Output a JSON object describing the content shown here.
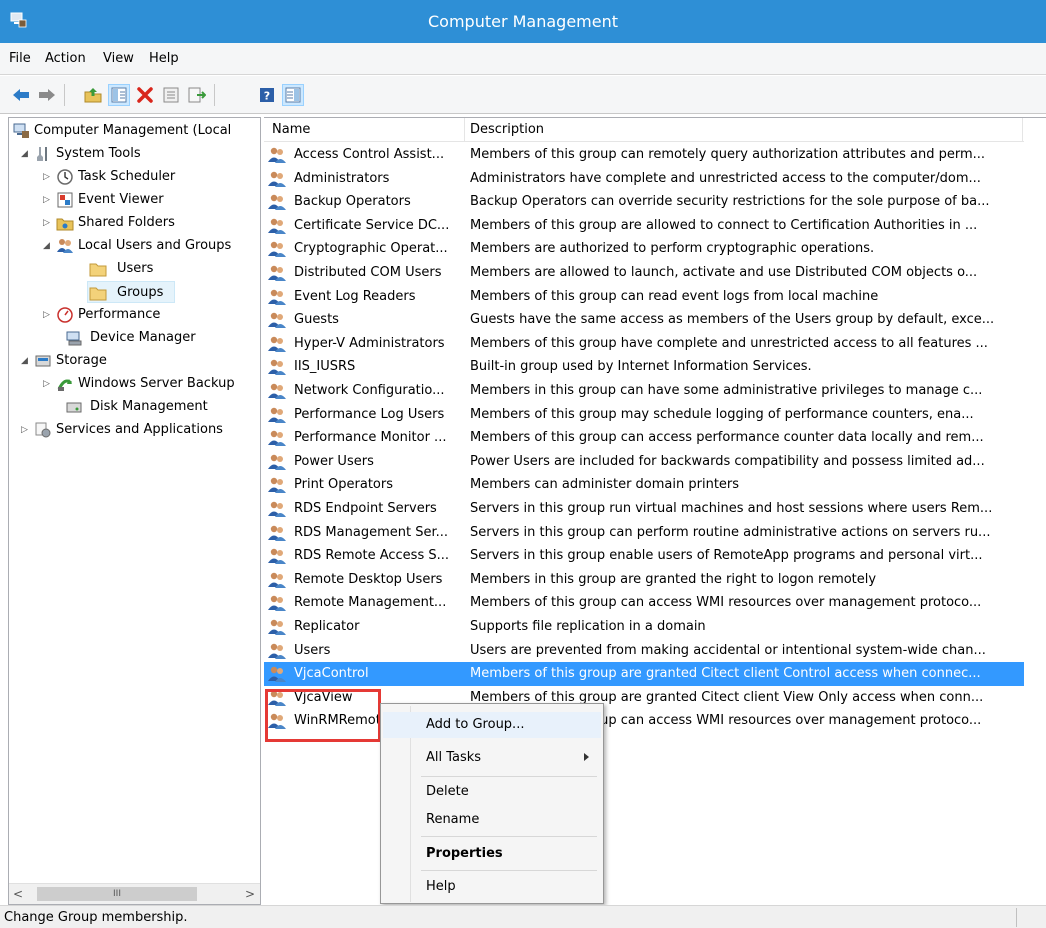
{
  "window": {
    "title": "Computer Management"
  },
  "menu": [
    "File",
    "Action",
    "View",
    "Help"
  ],
  "toolbar": [
    {
      "name": "back-icon"
    },
    {
      "name": "forward-icon"
    },
    {
      "name": "up-folder-icon"
    },
    {
      "name": "show-hide-console-tree-icon"
    },
    {
      "name": "delete-icon"
    },
    {
      "name": "properties-icon"
    },
    {
      "name": "export-list-icon"
    },
    {
      "name": "help-icon"
    },
    {
      "name": "show-hide-action-pane-icon"
    }
  ],
  "tree": [
    {
      "label": "Computer Management (Local",
      "icon": "computer-management-icon",
      "level": 0,
      "arrow": ""
    },
    {
      "label": "System Tools",
      "icon": "tools-icon",
      "level": 1,
      "arrow": "expanded"
    },
    {
      "label": "Task Scheduler",
      "icon": "clock-icon",
      "level": 2,
      "arrow": "collapsed"
    },
    {
      "label": "Event Viewer",
      "icon": "event-viewer-icon",
      "level": 2,
      "arrow": "collapsed"
    },
    {
      "label": "Shared Folders",
      "icon": "shared-folder-icon",
      "level": 2,
      "arrow": "collapsed"
    },
    {
      "label": "Local Users and Groups",
      "icon": "users-groups-icon",
      "level": 2,
      "arrow": "expanded"
    },
    {
      "label": "Users",
      "icon": "folder-icon",
      "level": 3,
      "arrow": ""
    },
    {
      "label": "Groups",
      "icon": "folder-icon",
      "level": 3,
      "arrow": "",
      "selected": true
    },
    {
      "label": "Performance",
      "icon": "performance-icon",
      "level": 2,
      "arrow": "collapsed"
    },
    {
      "label": "Device Manager",
      "icon": "device-manager-icon",
      "level": 2,
      "arrow": ""
    },
    {
      "label": "Storage",
      "icon": "storage-icon",
      "level": 1,
      "arrow": "expanded"
    },
    {
      "label": "Windows Server Backup",
      "icon": "backup-icon",
      "level": 2,
      "arrow": "collapsed"
    },
    {
      "label": "Disk Management",
      "icon": "disk-icon",
      "level": 2,
      "arrow": ""
    },
    {
      "label": "Services and Applications",
      "icon": "services-icon",
      "level": 1,
      "arrow": "collapsed"
    }
  ],
  "tree_scroll": {
    "thumb_label": "III"
  },
  "columns": {
    "name": "Name",
    "description": "Description"
  },
  "groups": [
    {
      "name": "Access Control Assist...",
      "description": "Members of this group can remotely query authorization attributes and perm..."
    },
    {
      "name": "Administrators",
      "description": "Administrators have complete and unrestricted access to the computer/dom..."
    },
    {
      "name": "Backup Operators",
      "description": "Backup Operators can override security restrictions for the sole purpose of ba..."
    },
    {
      "name": "Certificate Service DC...",
      "description": "Members of this group are allowed to connect to Certification Authorities in ..."
    },
    {
      "name": "Cryptographic Operat...",
      "description": "Members are authorized to perform cryptographic operations."
    },
    {
      "name": "Distributed COM Users",
      "description": "Members are allowed to launch, activate and use Distributed COM objects o..."
    },
    {
      "name": "Event Log Readers",
      "description": "Members of this group can read event logs from local machine"
    },
    {
      "name": "Guests",
      "description": "Guests have the same access as members of the Users group by default, exce..."
    },
    {
      "name": "Hyper-V Administrators",
      "description": "Members of this group have complete and unrestricted access to all features ..."
    },
    {
      "name": "IIS_IUSRS",
      "description": "Built-in group used by Internet Information Services."
    },
    {
      "name": "Network Configuratio...",
      "description": "Members in this group can have some administrative privileges to manage c..."
    },
    {
      "name": "Performance Log Users",
      "description": "Members of this group may schedule logging of performance counters, ena..."
    },
    {
      "name": "Performance Monitor ...",
      "description": "Members of this group can access performance counter data locally and rem..."
    },
    {
      "name": "Power Users",
      "description": "Power Users are included for backwards compatibility and possess limited ad..."
    },
    {
      "name": "Print Operators",
      "description": "Members can administer domain printers"
    },
    {
      "name": "RDS Endpoint Servers",
      "description": "Servers in this group run virtual machines and host sessions where users Rem..."
    },
    {
      "name": "RDS Management Ser...",
      "description": "Servers in this group can perform routine administrative actions on servers ru..."
    },
    {
      "name": "RDS Remote Access S...",
      "description": "Servers in this group enable users of RemoteApp programs and personal virt..."
    },
    {
      "name": "Remote Desktop Users",
      "description": "Members in this group are granted the right to logon remotely"
    },
    {
      "name": "Remote Management...",
      "description": "Members of this group can access WMI resources over management protoco..."
    },
    {
      "name": "Replicator",
      "description": "Supports file replication in a domain"
    },
    {
      "name": "Users",
      "description": "Users are prevented from making accidental or intentional system-wide chan..."
    },
    {
      "name": "VjcaControl",
      "description": "Members of this group are granted Citect client Control access when connec...",
      "selected": true
    },
    {
      "name": "VjcaView",
      "description": "Members of this group are granted Citect client View Only access when conn..."
    },
    {
      "name": "WinRMRemoteWMIUsers__",
      "description": "Members of this group can access WMI resources over management protoco..."
    }
  ],
  "context_menu": [
    {
      "label": "Add to Group...",
      "bold": false,
      "submenu": false,
      "highlighted": true
    },
    {
      "label": "All Tasks",
      "bold": false,
      "submenu": true
    },
    {
      "label": "Delete",
      "bold": false,
      "submenu": false
    },
    {
      "label": "Rename",
      "bold": false,
      "submenu": false
    },
    {
      "label": "Properties",
      "bold": true,
      "submenu": false
    },
    {
      "label": "Help",
      "bold": false,
      "submenu": false
    }
  ],
  "status": {
    "text": "Change Group membership."
  },
  "colors": {
    "titlebar": "#2e8fd6",
    "selection": "#3399ff",
    "highlight_box": "#e53935"
  }
}
